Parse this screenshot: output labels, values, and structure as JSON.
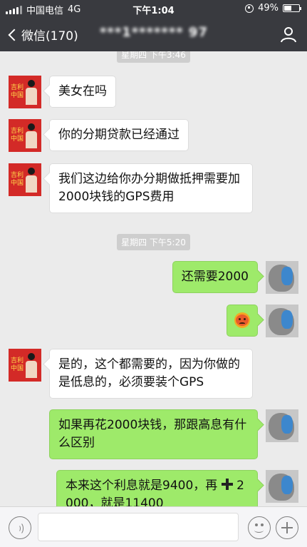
{
  "status_bar": {
    "carrier": "中国电信",
    "network": "4G",
    "time": "下午1:04",
    "battery": "49%",
    "battery_level": 0.49
  },
  "nav": {
    "back_label": "微信(170)",
    "title": "***1******* 97",
    "right_icon": "user-icon"
  },
  "messages": [
    {
      "type": "time",
      "text": "星期四 下午3:46"
    },
    {
      "type": "text",
      "side": "left",
      "text": "美女在吗"
    },
    {
      "type": "text",
      "side": "left",
      "text": "你的分期贷款已经通过"
    },
    {
      "type": "text",
      "side": "left",
      "text": "我们这边给你办分期做抵押需要加2000块钱的GPS费用"
    },
    {
      "type": "time",
      "text": "星期四 下午5:20"
    },
    {
      "type": "text",
      "side": "right",
      "text": "还需要2000"
    },
    {
      "type": "emoji",
      "side": "right",
      "icon": "angry-face-emoji"
    },
    {
      "type": "text",
      "side": "left",
      "text": "是的，这个都需要的，因为你做的是低息的，必须要装个GPS"
    },
    {
      "type": "text",
      "side": "right",
      "text": "如果再花2000块钱，那跟高息有什么区别"
    },
    {
      "type": "text",
      "side": "right",
      "text": "本来这个利息就是9400，再",
      "text_after_icon": "2000，就是11400",
      "icon": "plus-icon"
    }
  ],
  "input_bar": {
    "voice_icon": "voice-icon",
    "input_value": "",
    "emoji_icon": "emoji-icon",
    "plus_icon": "plus-icon"
  },
  "avatar_left_text": "吉利中国",
  "colors": {
    "nav_bg": "#393a3f",
    "chat_bg": "#ebebeb",
    "bubble_right": "#9eea6a",
    "bubble_left": "#ffffff"
  }
}
